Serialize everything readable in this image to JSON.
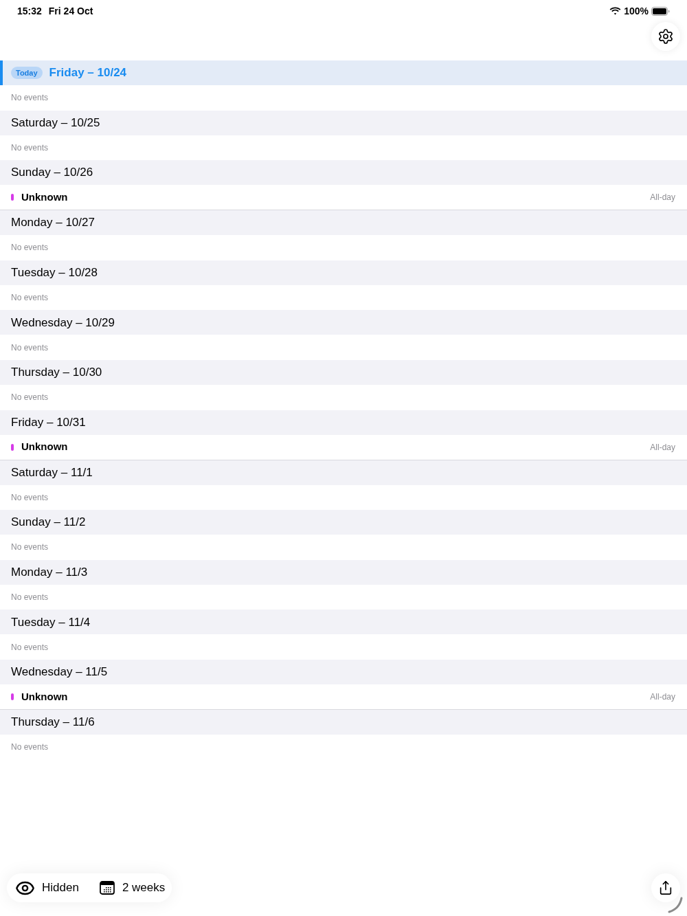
{
  "status_bar": {
    "time": "15:32",
    "date": "Fri 24 Oct",
    "battery": "100%"
  },
  "days": [
    {
      "title": "Friday – 10/24",
      "today": true,
      "badge": "Today",
      "empty_text": "No events"
    },
    {
      "title": "Saturday – 10/25",
      "today": false,
      "empty_text": "No events"
    },
    {
      "title": "Sunday – 10/26",
      "today": false,
      "events": [
        {
          "title": "Unknown",
          "time": "All-day",
          "color": "#d63be8"
        }
      ]
    },
    {
      "title": "Monday – 10/27",
      "today": false,
      "empty_text": "No events"
    },
    {
      "title": "Tuesday – 10/28",
      "today": false,
      "empty_text": "No events"
    },
    {
      "title": "Wednesday – 10/29",
      "today": false,
      "empty_text": "No events"
    },
    {
      "title": "Thursday – 10/30",
      "today": false,
      "empty_text": "No events"
    },
    {
      "title": "Friday – 10/31",
      "today": false,
      "events": [
        {
          "title": "Unknown",
          "time": "All-day",
          "color": "#d63be8"
        }
      ]
    },
    {
      "title": "Saturday – 11/1",
      "today": false,
      "empty_text": "No events"
    },
    {
      "title": "Sunday – 11/2",
      "today": false,
      "empty_text": "No events"
    },
    {
      "title": "Monday – 11/3",
      "today": false,
      "empty_text": "No events"
    },
    {
      "title": "Tuesday – 11/4",
      "today": false,
      "empty_text": "No events"
    },
    {
      "title": "Wednesday – 11/5",
      "today": false,
      "events": [
        {
          "title": "Unknown",
          "time": "All-day",
          "color": "#d63be8"
        }
      ]
    },
    {
      "title": "Thursday – 11/6",
      "today": false,
      "empty_text": "No events"
    }
  ],
  "toolbar": {
    "visibility": "Hidden",
    "range": "2 weeks"
  }
}
